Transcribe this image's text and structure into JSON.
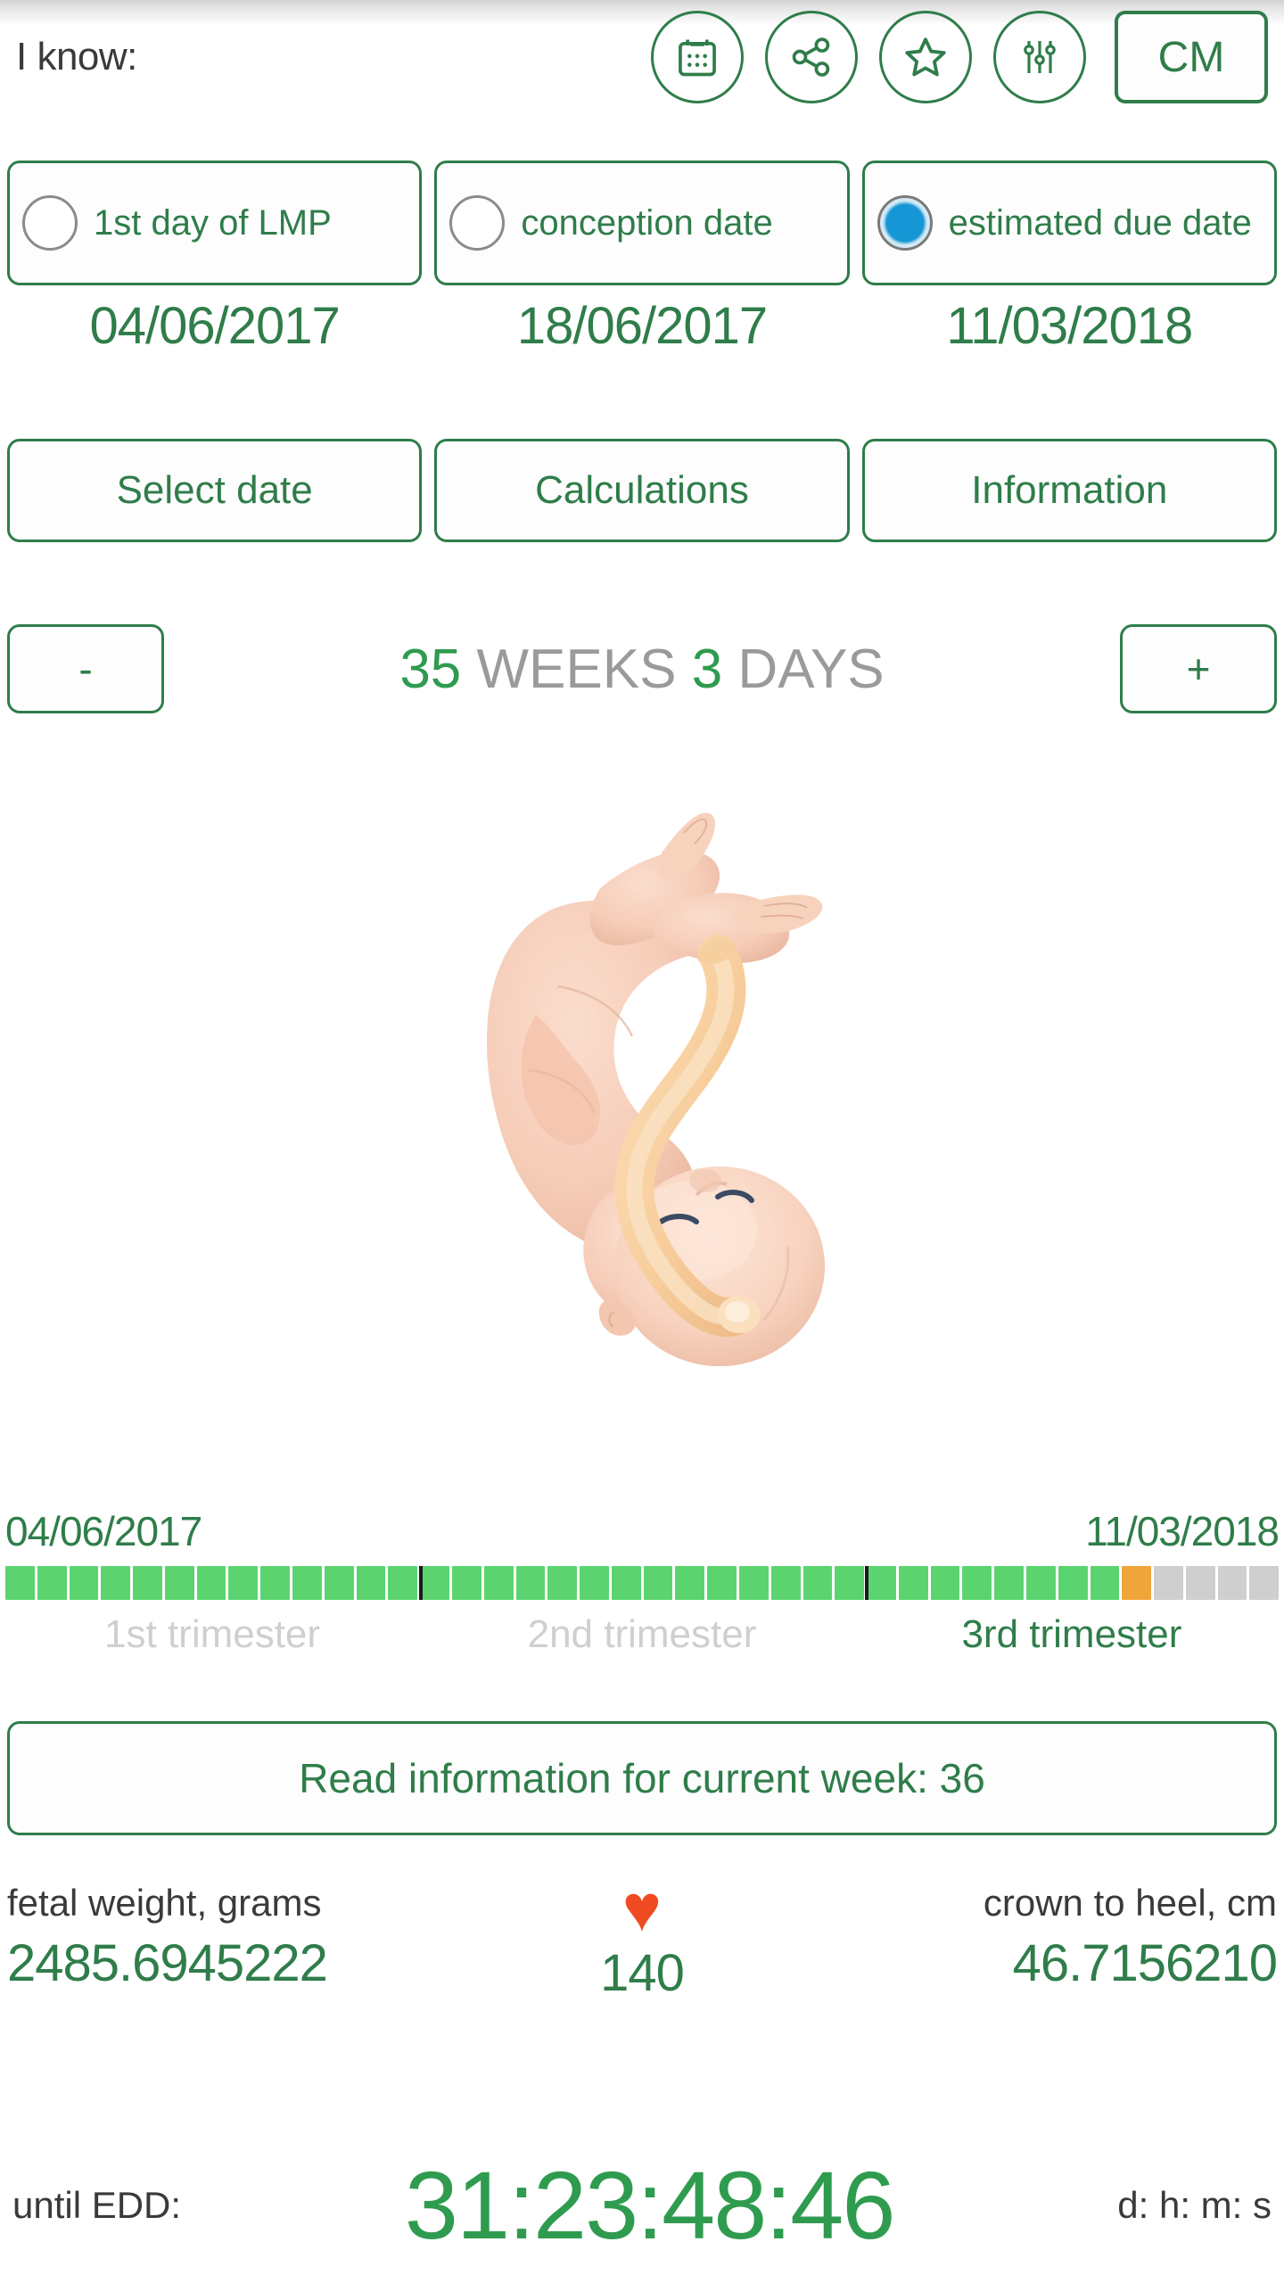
{
  "header": {
    "know_label": "I know:",
    "icons": [
      {
        "name": "calendar-icon",
        "label": "calendar"
      },
      {
        "name": "share-icon",
        "label": "share"
      },
      {
        "name": "star-icon",
        "label": "favorite"
      },
      {
        "name": "sliders-icon",
        "label": "settings"
      }
    ],
    "unit_button": "CM"
  },
  "input_modes": [
    {
      "label": "1st day of LMP",
      "selected": false,
      "date": "04/06/2017"
    },
    {
      "label": "conception date",
      "selected": false,
      "date": "18/06/2017"
    },
    {
      "label": "estimated due date",
      "selected": true,
      "date": "11/03/2018"
    }
  ],
  "actions": {
    "select_date": "Select date",
    "calculations": "Calculations",
    "information": "Information"
  },
  "gestation": {
    "minus": "-",
    "plus": "+",
    "weeks_value": "35",
    "weeks_unit": "WEEKS",
    "days_value": "3",
    "days_unit": "DAYS"
  },
  "timeline": {
    "start_date": "04/06/2017",
    "end_date": "11/03/2018",
    "total_segments": 40,
    "completed_segments": 35,
    "current_segment_index": 35,
    "trimesters": [
      {
        "label": "1st trimester",
        "active": false
      },
      {
        "label": "2nd trimester",
        "active": false
      },
      {
        "label": "3rd trimester",
        "active": true
      }
    ],
    "divider_positions": [
      13,
      27
    ]
  },
  "read_info_button": "Read information for current week: 36",
  "stats": {
    "weight": {
      "label": "fetal weight, grams",
      "value": "2485.6945222"
    },
    "heart": {
      "icon": "heart-icon",
      "glyph": "♥",
      "value": "140"
    },
    "length": {
      "label": "crown to heel, cm",
      "value": "46.7156210"
    }
  },
  "countdown": {
    "label": "until EDD:",
    "value": "31:23:48:46",
    "units": "d: h: m: s"
  },
  "colors": {
    "green": "#2f7d4a",
    "bright_green": "#2f9b4f",
    "bar_done": "#5bd470",
    "bar_now": "#efa53a",
    "bar_future": "#cfcfcf",
    "radio_blue": "#1497d4",
    "heart_red": "#f04a22",
    "muted_grey": "#9a9a9a"
  }
}
